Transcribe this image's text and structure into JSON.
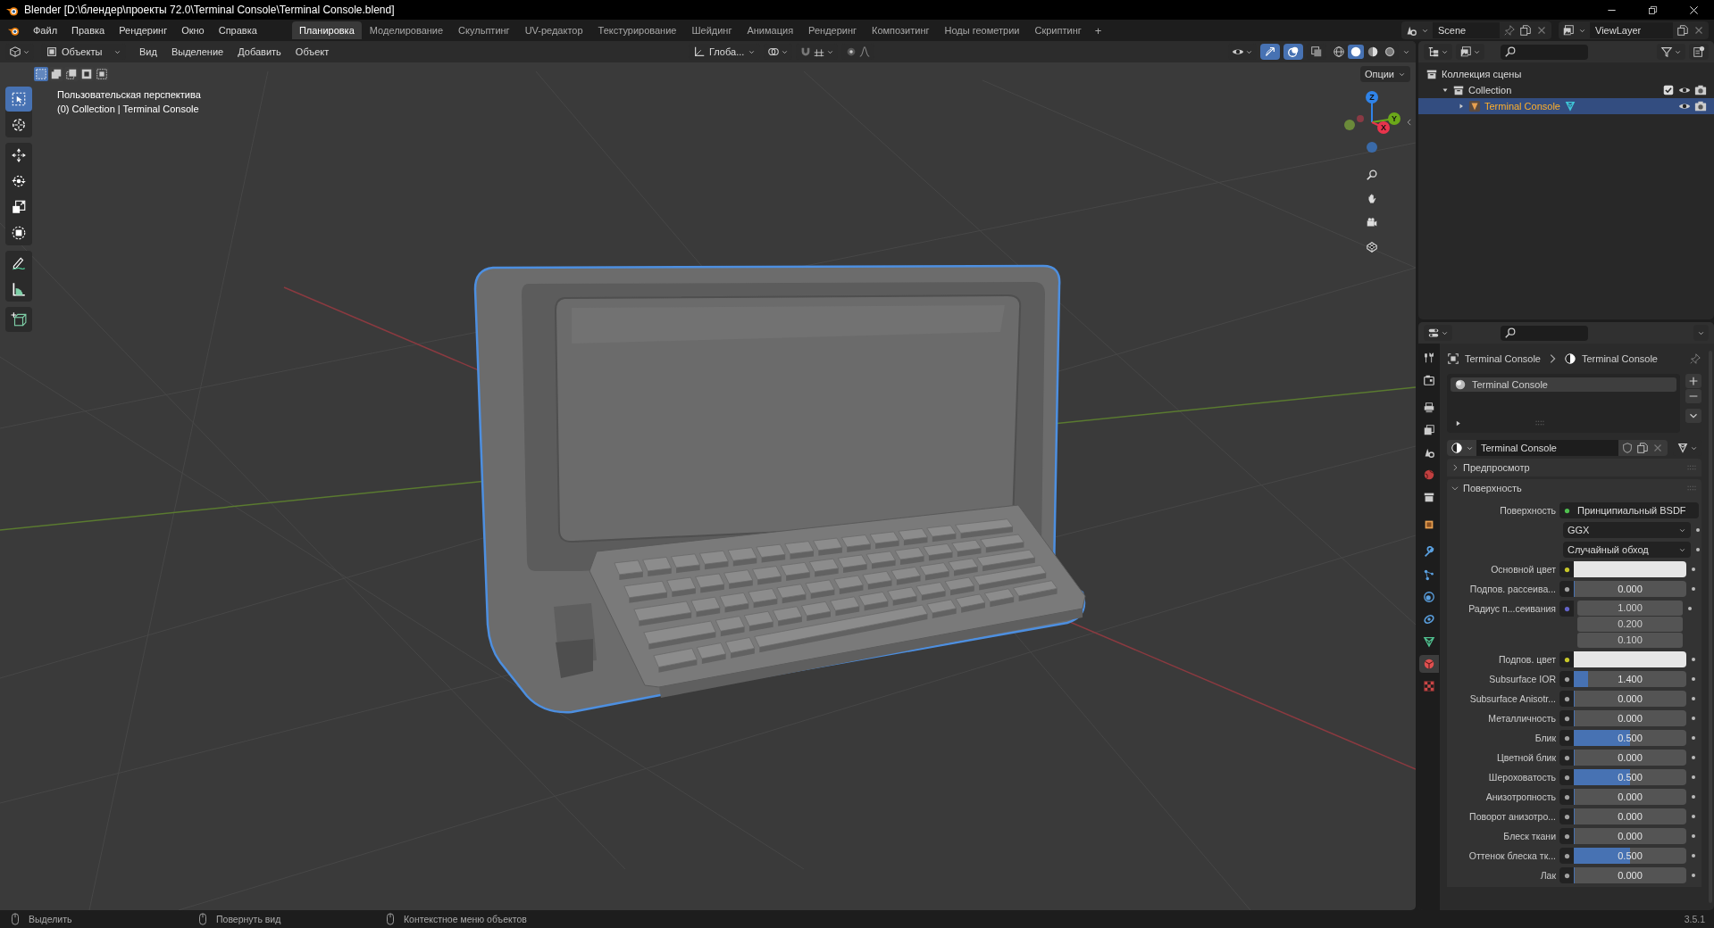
{
  "window": {
    "title": "Blender [D:\\блендер\\проекты 72.0\\Terminal Console\\Terminal Console.blend]"
  },
  "menu": [
    "Файл",
    "Правка",
    "Рендеринг",
    "Окно",
    "Справка"
  ],
  "workspaces": [
    {
      "label": "Планировка",
      "selected": true
    },
    {
      "label": "Моделирование",
      "selected": false
    },
    {
      "label": "Скульптинг",
      "selected": false
    },
    {
      "label": "UV-редактор",
      "selected": false
    },
    {
      "label": "Текстурирование",
      "selected": false
    },
    {
      "label": "Шейдинг",
      "selected": false
    },
    {
      "label": "Анимация",
      "selected": false
    },
    {
      "label": "Рендеринг",
      "selected": false
    },
    {
      "label": "Композитинг",
      "selected": false
    },
    {
      "label": "Ноды геометрии",
      "selected": false
    },
    {
      "label": "Скриптинг",
      "selected": false
    }
  ],
  "workspace_add": "+",
  "scene": {
    "name": "Scene"
  },
  "view_layer": {
    "name": "ViewLayer"
  },
  "viewport": {
    "mode": "Объекты",
    "menus": [
      "Вид",
      "Выделение",
      "Добавить",
      "Объект"
    ],
    "orientation": "Глоба...",
    "options": "Опции",
    "select_modes": [
      {
        "selected": true
      },
      {
        "selected": false
      },
      {
        "selected": false
      },
      {
        "selected": false
      },
      {
        "selected": false
      }
    ],
    "toggles": [
      {
        "kind": "gizmos",
        "on": true
      },
      {
        "kind": "overlays",
        "on": true
      },
      {
        "kind": "xray",
        "on": false
      }
    ],
    "shading": [
      {
        "kind": "wireframe",
        "selected": false
      },
      {
        "kind": "solid",
        "selected": true
      },
      {
        "kind": "material",
        "selected": false
      },
      {
        "kind": "rendered",
        "selected": false
      }
    ],
    "overlay_text": [
      "Пользовательская перспектива",
      "(0) Collection | Terminal Console"
    ],
    "tool_groups": [
      [
        {
          "kind": "select",
          "selected": true
        },
        {
          "kind": "cursor",
          "selected": false
        }
      ],
      [
        {
          "kind": "move",
          "selected": false
        },
        {
          "kind": "rotate",
          "selected": false
        },
        {
          "kind": "scale",
          "selected": false
        },
        {
          "kind": "transform",
          "selected": false
        }
      ],
      [
        {
          "kind": "annotate",
          "selected": false
        },
        {
          "kind": "measure",
          "selected": false
        }
      ],
      [
        {
          "kind": "add_cube",
          "selected": false
        }
      ]
    ],
    "gizmo_axes": [
      "Z",
      "Y",
      "X"
    ]
  },
  "outliner": {
    "items": [
      {
        "label": "Коллекция сцены",
        "kind": "scene_collection",
        "selected": false,
        "children": [
          {
            "label": "Collection",
            "kind": "collection",
            "selected": false,
            "expanded": true,
            "checked": true,
            "children": [
              {
                "label": "Terminal Console",
                "kind": "mesh_object",
                "selected": true,
                "expanded": false
              }
            ]
          }
        ]
      }
    ]
  },
  "properties": {
    "tabs": [
      {
        "kind": "tool",
        "selected": false
      },
      {
        "kind": "render",
        "selected": false
      },
      {
        "kind": "output",
        "selected": false
      },
      {
        "kind": "view_layer",
        "selected": false
      },
      {
        "kind": "scene",
        "selected": false
      },
      {
        "kind": "world",
        "selected": false
      },
      {
        "kind": "collection",
        "selected": false
      },
      {
        "kind": "object",
        "selected": false
      },
      {
        "kind": "modifiers",
        "selected": false
      },
      {
        "kind": "particles",
        "selected": false
      },
      {
        "kind": "physics",
        "selected": false
      },
      {
        "kind": "constraints",
        "selected": false
      },
      {
        "kind": "data",
        "selected": false
      },
      {
        "kind": "material",
        "selected": true
      },
      {
        "kind": "texture",
        "selected": false
      }
    ],
    "breadcrumb": [
      "Terminal Console",
      "Terminal Console"
    ],
    "material_slots": [
      {
        "label": "Terminal Console",
        "selected": true
      }
    ],
    "material_name": "Terminal Console",
    "panels": [
      {
        "label": "Предпросмотр",
        "expanded": false
      },
      {
        "label": "Поверхность",
        "expanded": true
      }
    ],
    "rows": [
      {
        "kind": "link",
        "label": "Поверхность",
        "value": "Принципиальный BSDF"
      },
      {
        "kind": "dropdown",
        "value": "GGX"
      },
      {
        "kind": "dropdown",
        "value": "Случайный обход"
      },
      {
        "kind": "color",
        "label": "Основной цвет",
        "color": "#e6e6e6"
      },
      {
        "kind": "slider",
        "label": "Подпов. рассеива...",
        "value": "0.000",
        "level": 0
      },
      {
        "kind": "vector",
        "label": "Радиус п...сеивания",
        "values": [
          "1.000",
          "0.200",
          "0.100"
        ]
      },
      {
        "kind": "color",
        "label": "Подпов. цвет",
        "color": "#e6e6e6"
      },
      {
        "kind": "slider",
        "label": "Subsurface IOR",
        "value": "1.400",
        "level": 0.13
      },
      {
        "kind": "slider",
        "label": "Subsurface Anisotr...",
        "value": "0.000",
        "level": 0
      },
      {
        "kind": "slider",
        "label": "Металличность",
        "value": "0.000",
        "level": 0
      },
      {
        "kind": "slider",
        "label": "Блик",
        "value": "0.500",
        "level": 0.5
      },
      {
        "kind": "slider",
        "label": "Цветной блик",
        "value": "0.000",
        "level": 0
      },
      {
        "kind": "slider",
        "label": "Шероховатость",
        "value": "0.500",
        "level": 0.5
      },
      {
        "kind": "slider",
        "label": "Анизотропность",
        "value": "0.000",
        "level": 0
      },
      {
        "kind": "slider",
        "label": "Поворот анизотро...",
        "value": "0.000",
        "level": 0
      },
      {
        "kind": "slider",
        "label": "Блеск ткани",
        "value": "0.000",
        "level": 0
      },
      {
        "kind": "slider",
        "label": "Оттенок блеска тк...",
        "value": "0.500",
        "level": 0.5
      },
      {
        "kind": "slider",
        "label": "Лак",
        "value": "0.000",
        "level": 0
      }
    ]
  },
  "status_bar": {
    "hints": [
      "Выделить",
      "Повернуть вид",
      "Контекстное меню объектов"
    ],
    "version": "3.5.1"
  }
}
